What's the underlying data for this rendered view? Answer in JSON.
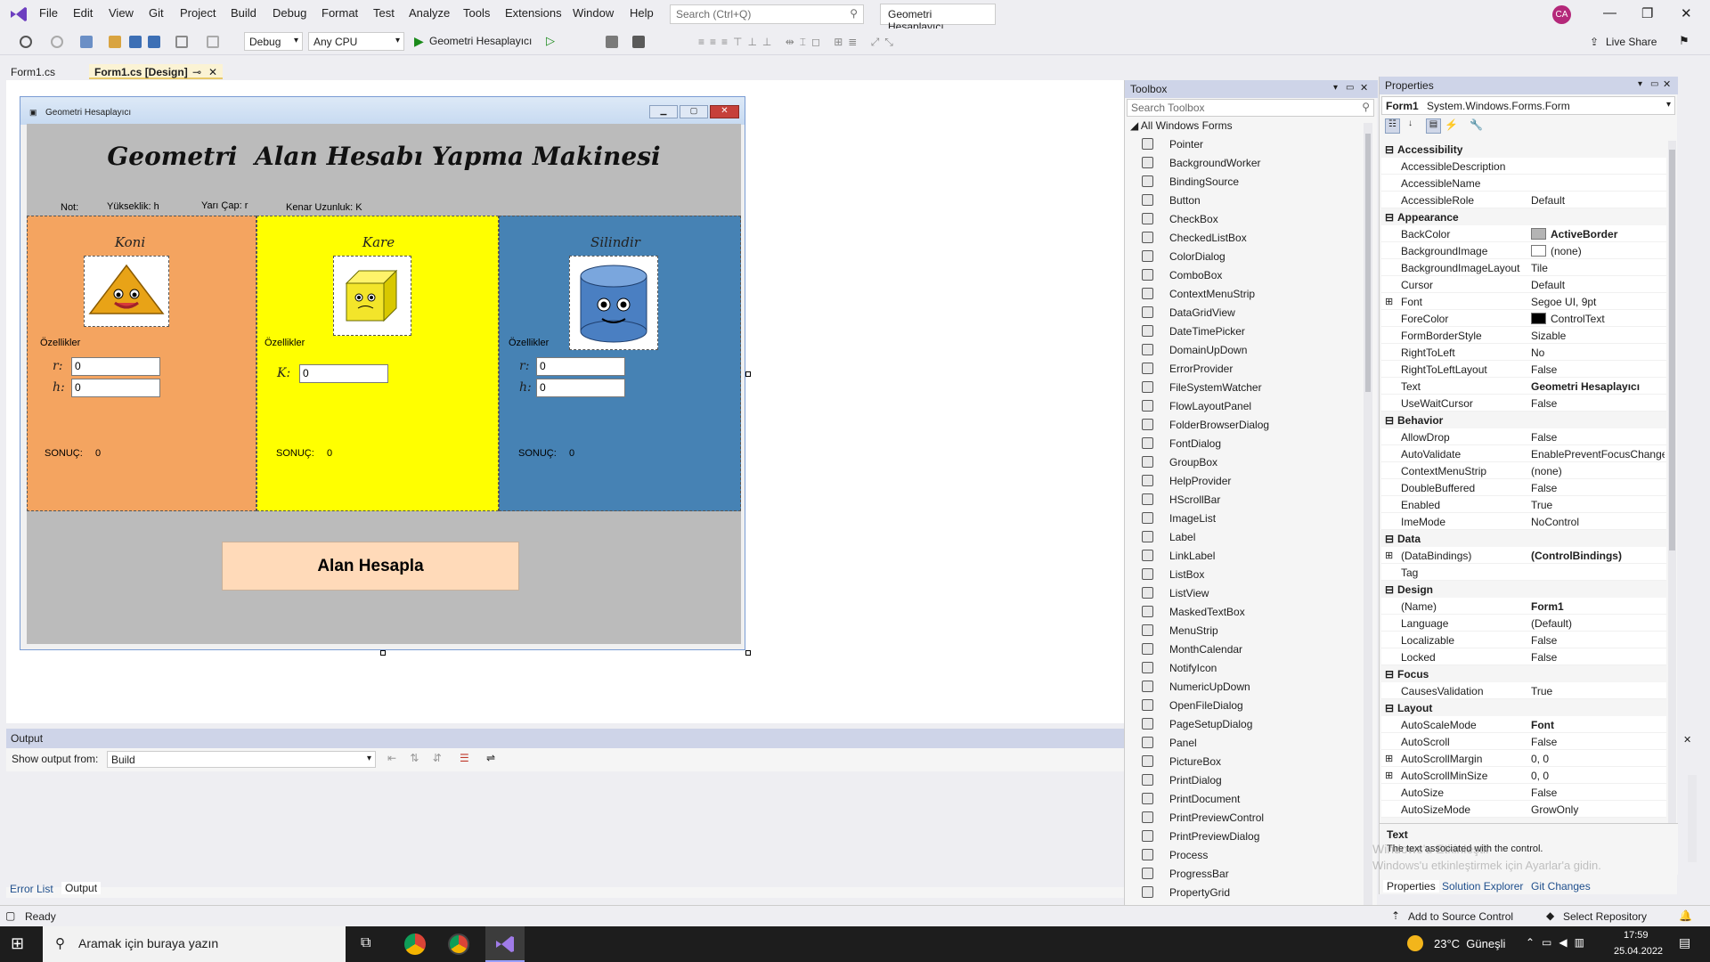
{
  "menu": {
    "items": [
      "File",
      "Edit",
      "View",
      "Git",
      "Project",
      "Build",
      "Debug",
      "Format",
      "Test",
      "Analyze",
      "Tools",
      "Extensions",
      "Window",
      "Help"
    ],
    "search_placeholder": "Search (Ctrl+Q)",
    "solution_title": "Geometri Hesaplayıcı",
    "avatar_initials": "CA"
  },
  "toolbar": {
    "config": "Debug",
    "platform": "Any CPU",
    "run_target": "Geometri Hesaplayıcı",
    "live_share": "Live Share"
  },
  "tabs": [
    {
      "label": "Form1.cs",
      "active": false
    },
    {
      "label": "Form1.cs [Design]",
      "active": true
    }
  ],
  "form": {
    "window_title": "Geometri Hesaplayıcı",
    "heading": "Geometri  Alan Hesabı Yapma Makinesi",
    "note_label": "Not:",
    "note_height": "Yükseklik: h",
    "note_radius": "Yarı Çap: r",
    "note_edge": "Kenar Uzunluk: K",
    "panels": {
      "koni": {
        "title": "Koni",
        "props_label": "Özellikler",
        "r_label": "r:",
        "r_value": "0",
        "h_label": "h:",
        "h_value": "0",
        "result_label": "SONUÇ:",
        "result_value": "0",
        "color": "#f4a460"
      },
      "kare": {
        "title": "Kare",
        "props_label": "Özellikler",
        "k_label": "K:",
        "k_value": "0",
        "result_label": "SONUÇ:",
        "result_value": "0",
        "color": "#ffff00"
      },
      "silindir": {
        "title": "Silindir",
        "props_label": "Özellikler",
        "r_label": "r:",
        "r_value": "0",
        "h_label": "h:",
        "h_value": "0",
        "result_label": "SONUÇ:",
        "result_value": "0",
        "color": "#4682b4"
      }
    },
    "calc_button": "Alan Hesapla"
  },
  "toolbox": {
    "title": "Toolbox",
    "search_placeholder": "Search Toolbox",
    "group": "All Windows Forms",
    "items": [
      "Pointer",
      "BackgroundWorker",
      "BindingSource",
      "Button",
      "CheckBox",
      "CheckedListBox",
      "ColorDialog",
      "ComboBox",
      "ContextMenuStrip",
      "DataGridView",
      "DateTimePicker",
      "DomainUpDown",
      "ErrorProvider",
      "FileSystemWatcher",
      "FlowLayoutPanel",
      "FolderBrowserDialog",
      "FontDialog",
      "GroupBox",
      "HelpProvider",
      "HScrollBar",
      "ImageList",
      "Label",
      "LinkLabel",
      "ListBox",
      "ListView",
      "MaskedTextBox",
      "MenuStrip",
      "MonthCalendar",
      "NotifyIcon",
      "NumericUpDown",
      "OpenFileDialog",
      "PageSetupDialog",
      "Panel",
      "PictureBox",
      "PrintDialog",
      "PrintDocument",
      "PrintPreviewControl",
      "PrintPreviewDialog",
      "Process",
      "ProgressBar",
      "PropertyGrid"
    ]
  },
  "properties": {
    "title": "Properties",
    "object_name": "Form1",
    "object_type": "System.Windows.Forms.Form",
    "rows": [
      {
        "cat": "Accessibility"
      },
      {
        "name": "AccessibleDescription",
        "value": ""
      },
      {
        "name": "AccessibleName",
        "value": ""
      },
      {
        "name": "AccessibleRole",
        "value": "Default"
      },
      {
        "cat": "Appearance"
      },
      {
        "name": "BackColor",
        "value": "ActiveBorder",
        "swatch": "#b4b4b4",
        "bold": true
      },
      {
        "name": "BackgroundImage",
        "value": "(none)",
        "swatch": "#ffffff"
      },
      {
        "name": "BackgroundImageLayout",
        "value": "Tile"
      },
      {
        "name": "Cursor",
        "value": "Default"
      },
      {
        "name": "Font",
        "value": "Segoe UI, 9pt",
        "expand": true
      },
      {
        "name": "ForeColor",
        "value": "ControlText",
        "swatch": "#000000"
      },
      {
        "name": "FormBorderStyle",
        "value": "Sizable"
      },
      {
        "name": "RightToLeft",
        "value": "No"
      },
      {
        "name": "RightToLeftLayout",
        "value": "False"
      },
      {
        "name": "Text",
        "value": "Geometri Hesaplayıcı",
        "bold": true
      },
      {
        "name": "UseWaitCursor",
        "value": "False"
      },
      {
        "cat": "Behavior"
      },
      {
        "name": "AllowDrop",
        "value": "False"
      },
      {
        "name": "AutoValidate",
        "value": "EnablePreventFocusChange"
      },
      {
        "name": "ContextMenuStrip",
        "value": "(none)"
      },
      {
        "name": "DoubleBuffered",
        "value": "False"
      },
      {
        "name": "Enabled",
        "value": "True"
      },
      {
        "name": "ImeMode",
        "value": "NoControl"
      },
      {
        "cat": "Data"
      },
      {
        "name": "(DataBindings)",
        "value": "(ControlBindings)",
        "bold": true,
        "expand": true
      },
      {
        "name": "Tag",
        "value": ""
      },
      {
        "cat": "Design"
      },
      {
        "name": "(Name)",
        "value": "Form1",
        "bold": true
      },
      {
        "name": "Language",
        "value": "(Default)"
      },
      {
        "name": "Localizable",
        "value": "False"
      },
      {
        "name": "Locked",
        "value": "False"
      },
      {
        "cat": "Focus"
      },
      {
        "name": "CausesValidation",
        "value": "True"
      },
      {
        "cat": "Layout"
      },
      {
        "name": "AutoScaleMode",
        "value": "Font",
        "bold": true
      },
      {
        "name": "AutoScroll",
        "value": "False"
      },
      {
        "name": "AutoScrollMargin",
        "value": "0, 0",
        "expand": true
      },
      {
        "name": "AutoScrollMinSize",
        "value": "0, 0",
        "expand": true
      },
      {
        "name": "AutoSize",
        "value": "False"
      },
      {
        "name": "AutoSizeMode",
        "value": "GrowOnly"
      }
    ],
    "desc_title": "Text",
    "desc_text": "The text associated with the control.",
    "watermark_line1": "Windows'u Etkinleştir",
    "watermark_line2": "Windows'u etkinleştirmek için Ayarlar'a gidin.",
    "bottom_tabs": [
      "Properties",
      "Solution Explorer",
      "Git Changes"
    ]
  },
  "output": {
    "title": "Output",
    "show_from_label": "Show output from:",
    "show_from_value": "Build",
    "bottom_tabs": [
      "Error List",
      "Output"
    ]
  },
  "status": {
    "ready": "Ready",
    "source_control": "Add to Source Control",
    "repository": "Select Repository"
  },
  "taskbar": {
    "search_placeholder": "Aramak için buraya yazın",
    "weather": "23°C  Güneşli",
    "time": "17:59",
    "date": "25.04.2022"
  }
}
